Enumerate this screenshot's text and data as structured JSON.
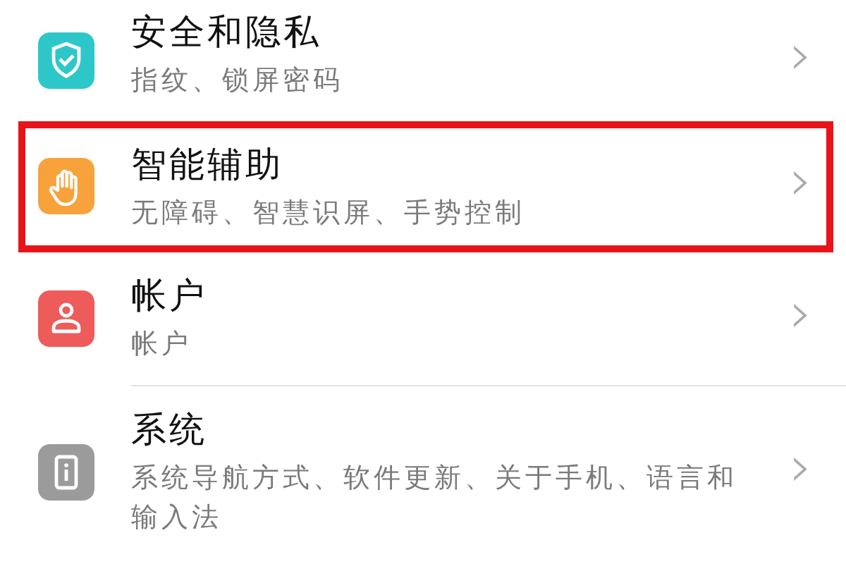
{
  "settings_items": [
    {
      "kind": "shield",
      "color": "#2ec7c9",
      "title": "安全和隐私",
      "subtitle": "指纹、锁屏密码",
      "highlighted": false,
      "chevron": "›"
    },
    {
      "kind": "hand",
      "color": "#f7a23b",
      "title": "智能辅助",
      "subtitle": "无障碍、智慧识屏、手势控制",
      "highlighted": true,
      "chevron": "›"
    },
    {
      "kind": "person",
      "color": "#ee5b5b",
      "title": "帐户",
      "subtitle": "帐户",
      "highlighted": false,
      "chevron": "›"
    },
    {
      "kind": "info",
      "color": "#9b9b9b",
      "title": "系统",
      "subtitle": "系统导航方式、软件更新、关于手机、语言和输入法",
      "highlighted": false,
      "chevron": "›"
    }
  ]
}
